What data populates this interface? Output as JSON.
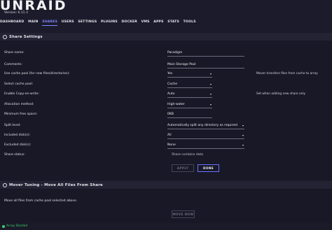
{
  "app": {
    "logo": "UNRAID",
    "version": "Version: 6.11.3"
  },
  "nav": [
    {
      "label": "DASHBOARD",
      "active": false
    },
    {
      "label": "MAIN",
      "active": false
    },
    {
      "label": "SHARES",
      "active": true
    },
    {
      "label": "USERS",
      "active": false
    },
    {
      "label": "SETTINGS",
      "active": false
    },
    {
      "label": "PLUGINS",
      "active": false
    },
    {
      "label": "DOCKER",
      "active": false
    },
    {
      "label": "VMS",
      "active": false
    },
    {
      "label": "APPS",
      "active": false
    },
    {
      "label": "STATS",
      "active": false
    },
    {
      "label": "TOOLS",
      "active": false
    }
  ],
  "share_settings": {
    "header": "Share Settings",
    "share_name": {
      "label": "Share name:",
      "value": "Paradigm"
    },
    "comments": {
      "label": "Comments:",
      "value": "Main Storage Pool"
    },
    "use_cache": {
      "label": "Use cache pool (for new files/directories):",
      "value": "Yes",
      "note": "Mover transfers files from cache to array"
    },
    "select_cache": {
      "label": "Select cache pool:",
      "value": "Cache"
    },
    "copy_on_write": {
      "label": "Enable Copy-on-write:",
      "value": "Auto",
      "note": "Set when adding new share only"
    },
    "allocation": {
      "label": "Allocation method:",
      "value": "High-water"
    },
    "min_free": {
      "label": "Minimum free space:",
      "value": "0KB"
    },
    "split_level": {
      "label": "Split level:",
      "value": "Automatically split any directory as required"
    },
    "included": {
      "label": "Included disk(s):",
      "value": "All"
    },
    "excluded": {
      "label": "Excluded disk(s):",
      "value": "None"
    },
    "status": {
      "label": "Share status:",
      "value": "Share contains data"
    },
    "apply_label": "APPLY",
    "done_label": "DONE"
  },
  "mover": {
    "header": "Mover Tuning - Move All Files From Share",
    "description": "Move all files from cache pool selected above.",
    "move_now_label": "MOVE NOW"
  },
  "statusbar": {
    "text": "Array Started",
    "color": "#3fcf6a"
  },
  "colors": {
    "accent": "#7f85ff",
    "background": "#1c1b2b"
  }
}
